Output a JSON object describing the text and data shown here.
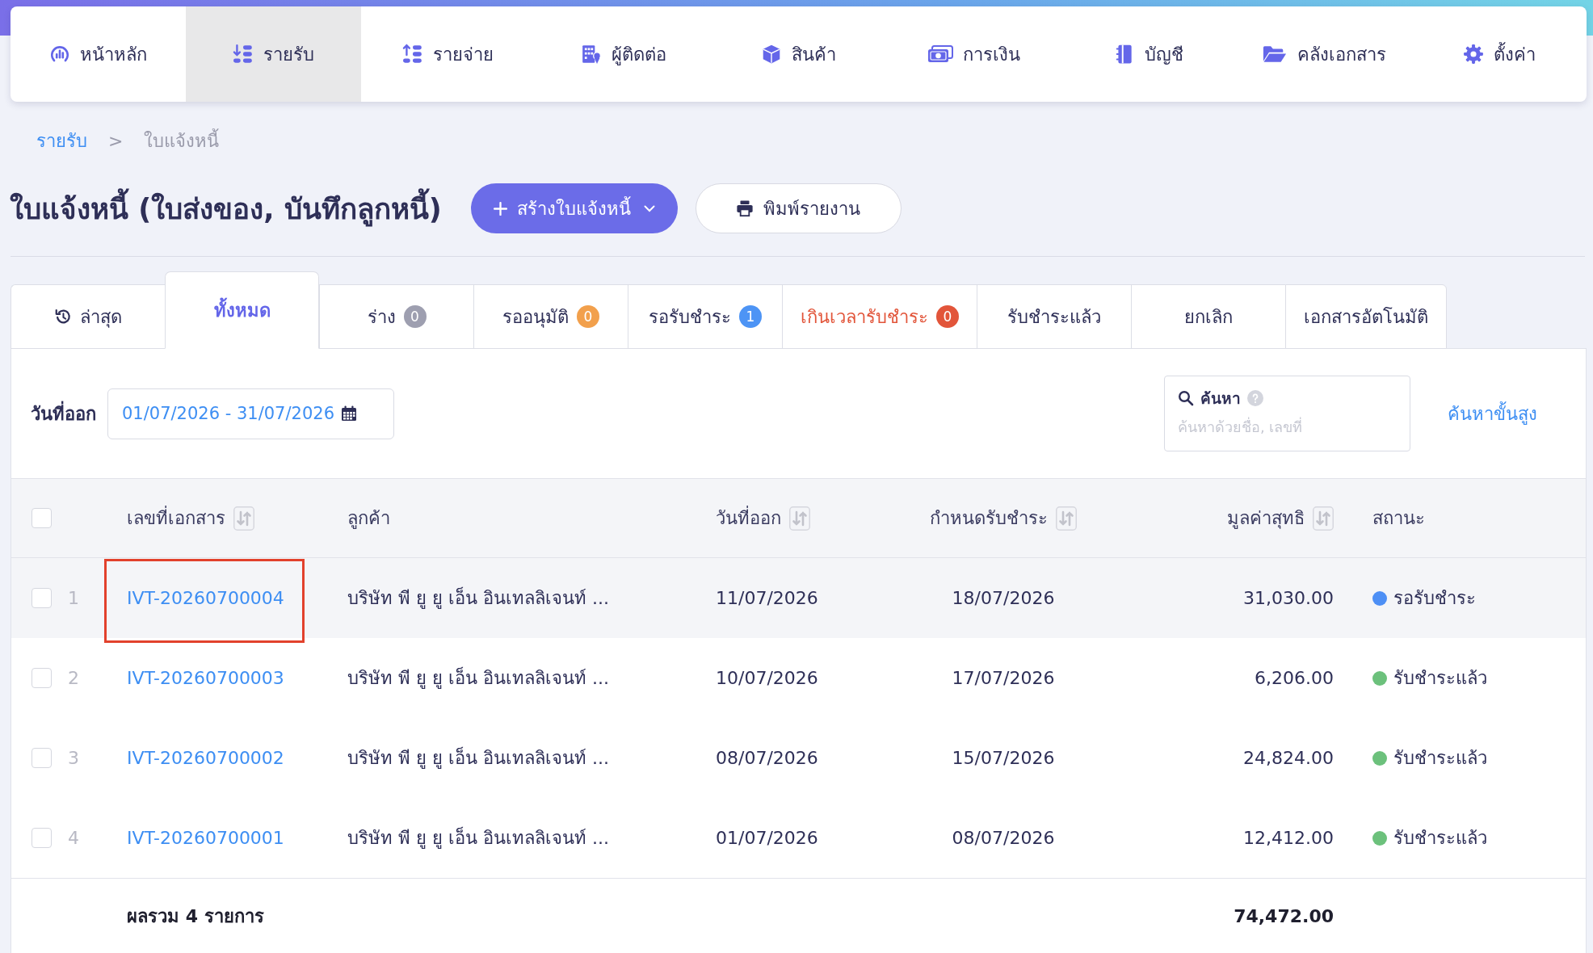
{
  "nav": {
    "items": [
      {
        "label": "หน้าหลัก",
        "selected": false
      },
      {
        "label": "รายรับ",
        "selected": true
      },
      {
        "label": "รายจ่าย",
        "selected": false
      },
      {
        "label": "ผู้ติดต่อ",
        "selected": false
      },
      {
        "label": "สินค้า",
        "selected": false
      },
      {
        "label": "การเงิน",
        "selected": false
      },
      {
        "label": "บัญชี",
        "selected": false
      },
      {
        "label": "คลังเอกสาร",
        "selected": false
      },
      {
        "label": "ตั้งค่า",
        "selected": false
      }
    ]
  },
  "breadcrumb": [
    {
      "kind": "link",
      "label": "รายรับ"
    },
    {
      "kind": "separator",
      "label": ">"
    },
    {
      "kind": "current",
      "label": "ใบแจ้งหนี้"
    }
  ],
  "page_title": "ใบแจ้งหนี้ (ใบส่งของ, บันทึกลูกหนี้)",
  "actions": [
    {
      "kind": "primary",
      "label": "สร้างใบแจ้งหนี้"
    },
    {
      "kind": "secondary",
      "label": "พิมพ์รายงาน"
    }
  ],
  "tabs": [
    {
      "kind": "icon",
      "label": "ล่าสุด",
      "selected": false,
      "alert": false
    },
    {
      "kind": "plain",
      "label": "ทั้งหมด",
      "selected": true,
      "alert": false
    },
    {
      "kind": "badge",
      "label": "ร่าง",
      "count": "0",
      "color": "#9e9fb0",
      "selected": false,
      "alert": false
    },
    {
      "kind": "badge",
      "label": "รออนุมัติ",
      "count": "0",
      "color": "#f2a04c",
      "selected": false,
      "alert": false
    },
    {
      "kind": "badge",
      "label": "รอรับชำระ",
      "count": "1",
      "color": "#4d94f5",
      "selected": false,
      "alert": false
    },
    {
      "kind": "badge",
      "label": "เกินเวลารับชำระ",
      "count": "0",
      "color": "#e2553a",
      "selected": false,
      "alert": true
    },
    {
      "kind": "plain",
      "label": "รับชำระแล้ว",
      "selected": false,
      "alert": false
    },
    {
      "kind": "plain",
      "label": "ยกเลิก",
      "selected": false,
      "alert": false
    },
    {
      "kind": "plain",
      "label": "เอกสารอัตโนมัติ",
      "selected": false,
      "alert": false
    }
  ],
  "filters": {
    "date": {
      "label": "วันที่ออก",
      "value": "01/07/2026 - 31/07/2026"
    },
    "search": {
      "label": "ค้นหา",
      "placeholder": "ค้นหาด้วยชื่อ, เลขที่"
    },
    "advanced_link": "ค้นหาขั้นสูง"
  },
  "table": {
    "select_all": {
      "checked": false
    },
    "columns": [
      {
        "label": "เลขที่เอกสาร",
        "sortable": true
      },
      {
        "label": "ลูกค้า",
        "sortable": false
      },
      {
        "label": "วันที่ออก",
        "sortable": true
      },
      {
        "label": "กำหนดรับชำระ",
        "sortable": true
      },
      {
        "label": "มูลค่าสุทธิ",
        "sortable": true
      },
      {
        "label": "สถานะ",
        "sortable": false
      }
    ],
    "rows": [
      {
        "number": "1",
        "checked": false,
        "hovered": true,
        "outlined": true,
        "document_no": "IVT-20260700004",
        "customer": "บริษัท พี ยู ยู เอ็น อินเทลลิเจนท์ ...",
        "issue_date": "11/07/2026",
        "due_date": "18/07/2026",
        "amount": "31,030.00",
        "status": {
          "label": "รอรับชำระ",
          "color": "#4d8ff5"
        }
      },
      {
        "number": "2",
        "checked": false,
        "hovered": false,
        "outlined": false,
        "document_no": "IVT-20260700003",
        "customer": "บริษัท พี ยู ยู เอ็น อินเทลลิเจนท์ ...",
        "issue_date": "10/07/2026",
        "due_date": "17/07/2026",
        "amount": "6,206.00",
        "status": {
          "label": "รับชำระแล้ว",
          "color": "#6cc17c"
        }
      },
      {
        "number": "3",
        "checked": false,
        "hovered": false,
        "outlined": false,
        "document_no": "IVT-20260700002",
        "customer": "บริษัท พี ยู ยู เอ็น อินเทลลิเจนท์ ...",
        "issue_date": "08/07/2026",
        "due_date": "15/07/2026",
        "amount": "24,824.00",
        "status": {
          "label": "รับชำระแล้ว",
          "color": "#6cc17c"
        }
      },
      {
        "number": "4",
        "checked": false,
        "hovered": false,
        "outlined": false,
        "document_no": "IVT-20260700001",
        "customer": "บริษัท พี ยู ยู เอ็น อินเทลลิเจนท์ ...",
        "issue_date": "01/07/2026",
        "due_date": "08/07/2026",
        "amount": "12,412.00",
        "status": {
          "label": "รับชำระแล้ว",
          "color": "#6cc17c"
        }
      }
    ],
    "total": {
      "label": "ผลรวม 4 รายการ",
      "amount": "74,472.00"
    }
  }
}
